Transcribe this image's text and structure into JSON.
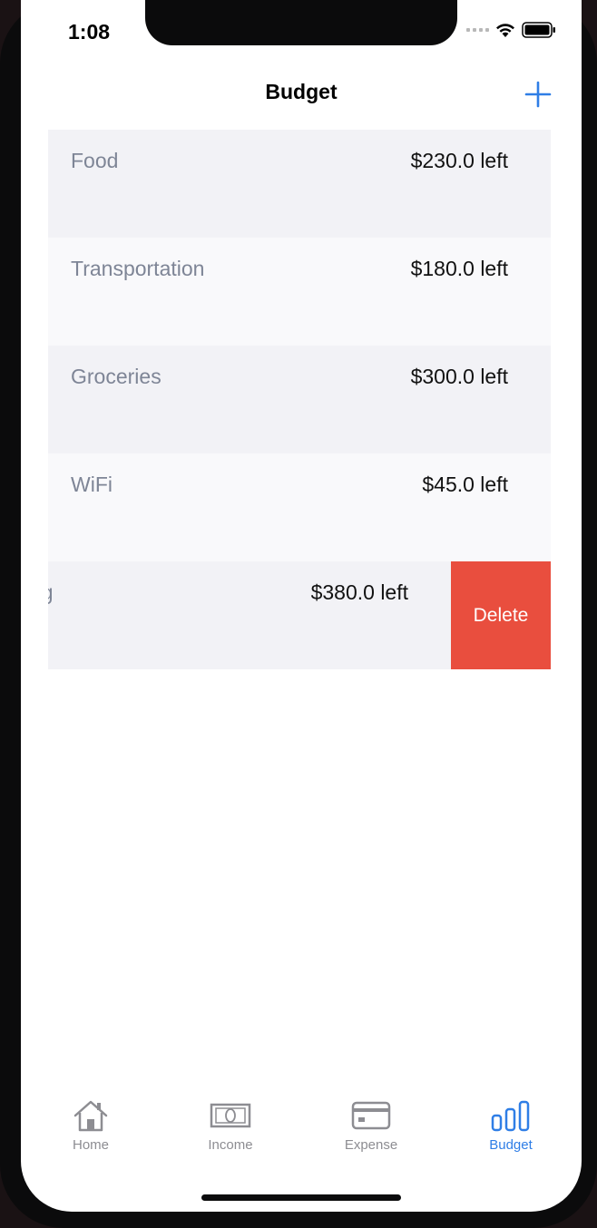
{
  "status_bar": {
    "time": "1:08"
  },
  "nav": {
    "title": "Budget"
  },
  "budgets": [
    {
      "name": "Food",
      "amount": "$230.0 left"
    },
    {
      "name": "Transportation",
      "amount": "$180.0 left"
    },
    {
      "name": "Groceries",
      "amount": "$300.0 left"
    },
    {
      "name": "WiFi",
      "amount": "$45.0 left"
    },
    {
      "name": "ng",
      "amount": "$380.0 left",
      "action": "Delete"
    }
  ],
  "tabs": [
    {
      "label": "Home",
      "icon": "house-icon"
    },
    {
      "label": "Income",
      "icon": "banknote-icon"
    },
    {
      "label": "Expense",
      "icon": "credit-card-icon"
    },
    {
      "label": "Budget",
      "icon": "bar-chart-icon",
      "active": true
    }
  ],
  "colors": {
    "accent": "#2f7ee6",
    "delete": "#e94e3e",
    "row_odd": "#f2f2f6",
    "row_even": "#f9f9fb"
  }
}
